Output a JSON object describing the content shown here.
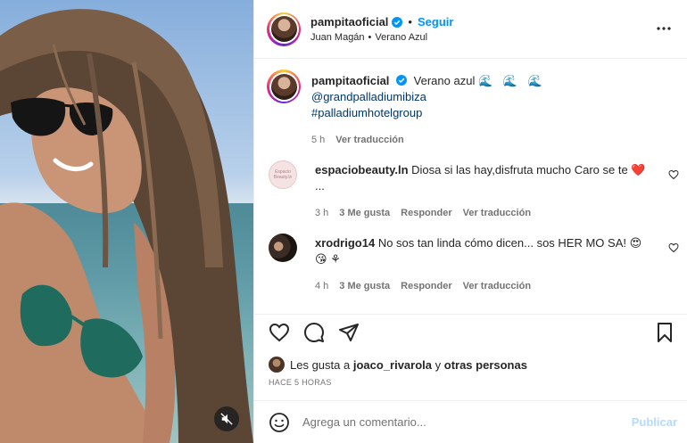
{
  "post": {
    "username": "pampitaoficial",
    "follow_label": "Seguir",
    "audio_artist": "Juan Magán",
    "audio_song": "Verano Azul",
    "dot": "•"
  },
  "caption": {
    "username": "pampitaoficial",
    "text": "Verano azul",
    "waves": "🌊 🌊 🌊",
    "mention": "@grandpalladiumibiza",
    "hashtag": "#palladiumhotelgroup",
    "age": "5 h",
    "translate_label": "Ver traducción"
  },
  "comments": [
    {
      "avatar_text": "Espacio Beauty.ln",
      "username": "espaciobeauty.ln",
      "text": "Diosa si las hay,disfruta mucho Caro se te ❤️ ...",
      "age": "3 h",
      "likes": "3 Me gusta",
      "reply_label": "Responder",
      "translate_label": "Ver traducción"
    },
    {
      "username": "xrodrigo14",
      "text": "No sos tan linda cómo dicen... sos HER MO SA! 😍 😘 ⚘",
      "age": "4 h",
      "likes": "3 Me gusta",
      "reply_label": "Responder",
      "translate_label": "Ver traducción"
    }
  ],
  "likes_line": {
    "prefix": "Les gusta a",
    "user": "joaco_rivarola",
    "joiner": "y",
    "others": "otras personas"
  },
  "timestamp": "HACE 5 HORAS",
  "comment_box": {
    "placeholder": "Agrega un comentario...",
    "publish_label": "Publicar"
  },
  "colors": {
    "link_blue": "#0095f6",
    "verified_blue": "#0095f6",
    "publish_disabled": "#b3dbff",
    "muted_text": "#737373"
  },
  "icons": [
    "ellipsis-icon",
    "verified-icon",
    "heart-icon",
    "comment-icon",
    "share-icon",
    "bookmark-icon",
    "emoji-icon",
    "mute-icon"
  ]
}
